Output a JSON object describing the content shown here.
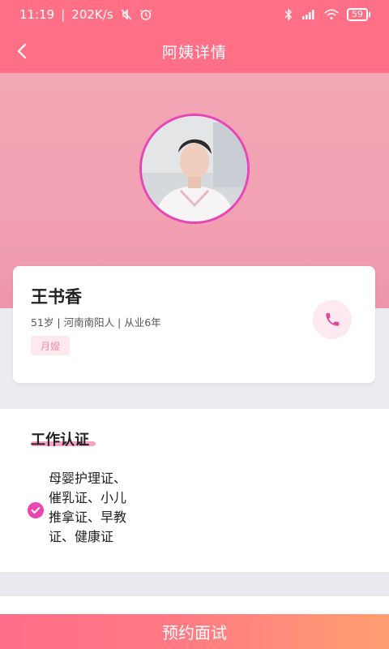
{
  "status_bar": {
    "time": "11:19",
    "network": "202K/s",
    "battery": "59"
  },
  "header": {
    "title": "阿姨详情"
  },
  "profile": {
    "name": "王书香",
    "meta": "51岁 | 河南南阳人 | 从业6年",
    "tag": "月嫂"
  },
  "certification": {
    "title": "工作认证",
    "items_text": [
      "母婴护理证、",
      "催乳证、小儿",
      "推拿证、早教",
      "证、健康证"
    ]
  },
  "bottom": {
    "booking_label": "预约面试"
  },
  "colors": {
    "brand": "#ff6f86",
    "accent": "#ea45b3",
    "tag_bg": "#fde9ee"
  },
  "icons": [
    "back-icon",
    "phone-icon",
    "check-icon",
    "bluetooth-icon",
    "wifi-icon",
    "alarm-icon",
    "mute-icon"
  ]
}
